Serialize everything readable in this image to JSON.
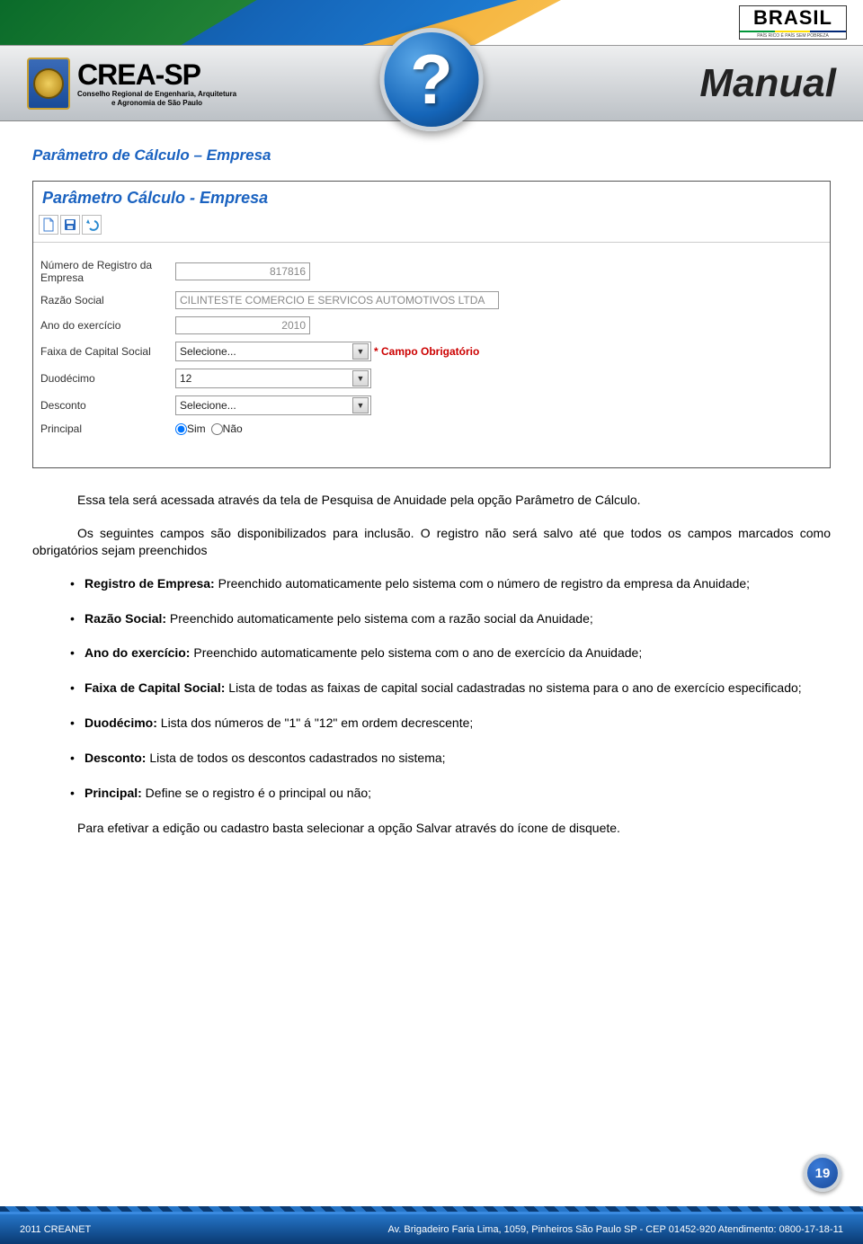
{
  "banner": {
    "brasil_text": "BRASIL",
    "brasil_sub": "PAÍS RICO É PAÍS SEM POBREZA"
  },
  "header": {
    "crea_main": "CREA-SP",
    "crea_sub1": "Conselho Regional de Engenharia, Arquitetura",
    "crea_sub2": "e Agronomia de São Paulo",
    "manual": "Manual",
    "q": "?"
  },
  "section_title": "Parâmetro de Cálculo – Empresa",
  "screenshot": {
    "title": "Parâmetro Cálculo - Empresa",
    "fields": {
      "registro_label": "Número de Registro da Empresa",
      "registro_value": "817816",
      "razao_label": "Razão Social",
      "razao_value": "CILINTESTE COMERCIO E SERVICOS AUTOMOTIVOS LTDA",
      "ano_label": "Ano do exercício",
      "ano_value": "2010",
      "faixa_label": "Faixa de Capital Social",
      "faixa_value": "Selecione...",
      "faixa_required": "* Campo Obrigatório",
      "duodecimo_label": "Duodécimo",
      "duodecimo_value": "12",
      "desconto_label": "Desconto",
      "desconto_value": "Selecione...",
      "principal_label": "Principal",
      "principal_sim": "Sim",
      "principal_nao": "Não"
    }
  },
  "body": {
    "p1": "Essa tela será acessada através da tela de Pesquisa de Anuidade pela opção Parâmetro de Cálculo.",
    "p2a": "Os seguintes campos são disponibilizados para inclusão. O registro não será salvo até que todos os campos marcados como obrigatórios sejam preenchidos",
    "items": [
      {
        "b": "Registro de Empresa:",
        "t": " Preenchido automaticamente pelo sistema com o número de registro da empresa da Anuidade;"
      },
      {
        "b": "Razão Social:",
        "t": " Preenchido automaticamente pelo sistema com a razão social da Anuidade;"
      },
      {
        "b": "Ano do exercício:",
        "t": " Preenchido automaticamente pelo sistema com o ano de exercício da Anuidade;"
      },
      {
        "b": "Faixa de Capital Social:",
        "t": " Lista de todas as faixas de capital social cadastradas no sistema para o ano de exercício especificado;"
      },
      {
        "b": "Duodécimo:",
        "t": " Lista dos números de \"1\" á \"12\" em ordem decrescente;"
      },
      {
        "b": "Desconto:",
        "t": " Lista de todos os descontos cadastrados no sistema;"
      },
      {
        "b": "Principal:",
        "t": " Define se o registro é o principal ou não;"
      }
    ],
    "p3": "Para efetivar a edição ou cadastro basta selecionar a opção Salvar através do ícone de disquete."
  },
  "page_number": "19",
  "footer": {
    "left": "2011 CREANET",
    "right": "Av. Brigadeiro Faria Lima, 1059, Pinheiros São Paulo SP - CEP 01452-920 Atendimento: 0800-17-18-11"
  }
}
